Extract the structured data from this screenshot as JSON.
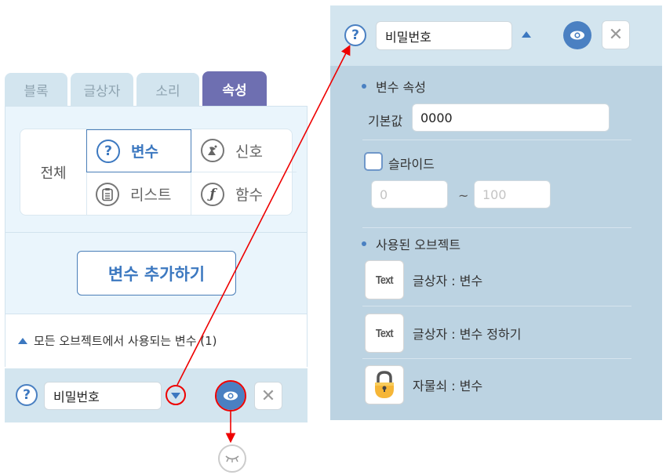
{
  "tabs": [
    {
      "label": "블록",
      "active": false
    },
    {
      "label": "글상자",
      "active": false
    },
    {
      "label": "소리",
      "active": false
    },
    {
      "label": "속성",
      "active": true
    }
  ],
  "categories": {
    "all_label": "전체",
    "items": [
      {
        "label": "변수",
        "icon": "question-icon",
        "selected": true
      },
      {
        "label": "신호",
        "icon": "satellite-dish-icon",
        "selected": false
      },
      {
        "label": "리스트",
        "icon": "clipboard-icon",
        "selected": false
      },
      {
        "label": "함수",
        "icon": "function-icon",
        "selected": false
      }
    ]
  },
  "add_variable_button": "변수 추가하기",
  "global_variables_section": "모든 오브젝트에서 사용되는 변수 (1)",
  "variable": {
    "name": "비밀번호",
    "visible": true
  },
  "glyphs": {
    "question": "?",
    "close": "✕",
    "tilde": "~"
  },
  "properties": {
    "section_title": "변수 속성",
    "default_value_label": "기본값",
    "default_value": "0000",
    "slide_label": "슬라이드",
    "slide_checked": false,
    "slide_min": "0",
    "slide_max": "100",
    "used_objects_title": "사용된 오브젝트",
    "used_objects": [
      {
        "thumb": "Text",
        "thumb_type": "text-icon",
        "label": "글상자 : 변수"
      },
      {
        "thumb": "Text",
        "thumb_type": "text-icon",
        "label": "글상자 : 변수 정하기"
      },
      {
        "thumb": "",
        "thumb_type": "padlock-icon",
        "label": "자물쇠 : 변수"
      }
    ]
  },
  "colors": {
    "accent": "#4a80c2",
    "active_tab": "#6e6fb1",
    "annotation": "#e00000"
  }
}
